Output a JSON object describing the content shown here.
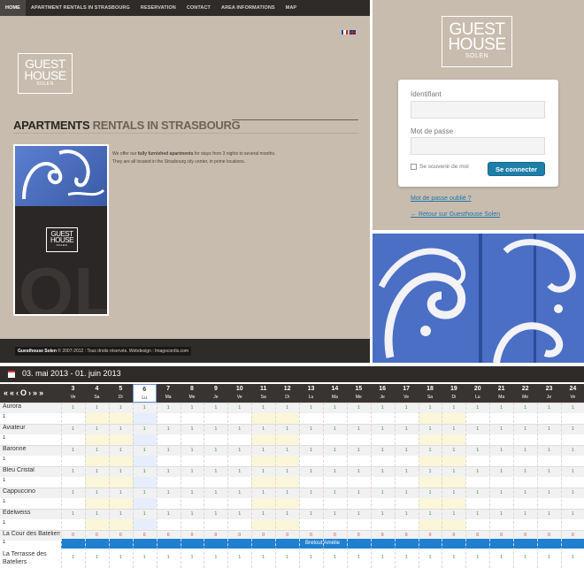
{
  "site": {
    "nav": [
      "HOME",
      "APARTMENT RENTALS IN STRASBOURG",
      "RESERVATION",
      "CONTACT",
      "AREA INFORMATIONS",
      "MAP"
    ],
    "logo": {
      "line1": "GUEST",
      "line2": "HOUSE",
      "line3": "SOLEN"
    },
    "title_bold": "APARTMENTS",
    "title_rest": " RENTALS IN STRASBOURG",
    "intro_line1_a": "We offer our ",
    "intro_line1_b": "fully furnished apartments",
    "intro_line1_c": " for stays from 3 nights to several months.",
    "intro_line2": "They are all located in the Strasbourg city center, in prime locations.",
    "footer_brand": "Guesthouse Solen",
    "footer_rest": " © 2007-2012 : Tous droits réservés. Webdesign : Imagocordis.com"
  },
  "login": {
    "logo": {
      "line1": "GUEST",
      "line2": "HOUSE",
      "line3": "SOLEN"
    },
    "identifiant_label": "Identifiant",
    "password_label": "Mot de passe",
    "remember_label": "Se souvenir de moi",
    "submit_label": "Se connecter",
    "forgot_link": "Mot de passe oublié ?",
    "back_link": "← Retour sur Guesthouse Solen"
  },
  "calendar": {
    "title": "03. mai 2013 - 01. juin 2013",
    "nav": [
      "«",
      "«",
      "‹",
      "O",
      "›",
      "»",
      "»"
    ],
    "days": [
      {
        "n": "3",
        "w": "Ve"
      },
      {
        "n": "4",
        "w": "Sa"
      },
      {
        "n": "5",
        "w": "Di"
      },
      {
        "n": "6",
        "w": "Lu"
      },
      {
        "n": "7",
        "w": "Ma"
      },
      {
        "n": "8",
        "w": "Me"
      },
      {
        "n": "9",
        "w": "Je"
      },
      {
        "n": "10",
        "w": "Ve"
      },
      {
        "n": "11",
        "w": "Sa"
      },
      {
        "n": "12",
        "w": "Di"
      },
      {
        "n": "13",
        "w": "Lu"
      },
      {
        "n": "14",
        "w": "Ma"
      },
      {
        "n": "15",
        "w": "Me"
      },
      {
        "n": "16",
        "w": "Je"
      },
      {
        "n": "17",
        "w": "Ve"
      },
      {
        "n": "18",
        "w": "Sa"
      },
      {
        "n": "19",
        "w": "Di"
      },
      {
        "n": "20",
        "w": "Lu"
      },
      {
        "n": "21",
        "w": "Ma"
      },
      {
        "n": "22",
        "w": "Me"
      },
      {
        "n": "23",
        "w": "Je"
      },
      {
        "n": "24",
        "w": "Ve"
      }
    ],
    "selected_day": "6",
    "apartments": [
      {
        "name": "Aurora",
        "count": "1",
        "value": "1"
      },
      {
        "name": "Aviateur",
        "count": "1",
        "value": "1"
      },
      {
        "name": "Baronne",
        "count": "1",
        "value": "1"
      },
      {
        "name": "Bleu Cristal",
        "count": "1",
        "value": "1"
      },
      {
        "name": "Cappuccino",
        "count": "1",
        "value": "1"
      },
      {
        "name": "Edelweiss",
        "count": "1",
        "value": "1"
      },
      {
        "name": "La Cour des Bateliers",
        "count": "1",
        "value": "0"
      }
    ],
    "last_row_label_1": "La Terrasse des",
    "last_row_label_2": "Bateliers",
    "booking_guest": "Bretout Amélie"
  },
  "colors": {
    "accent": "#1e7fa8",
    "booking": "#1f7fd1",
    "available": "#2a8a2a",
    "unavailable": "#d33333"
  }
}
